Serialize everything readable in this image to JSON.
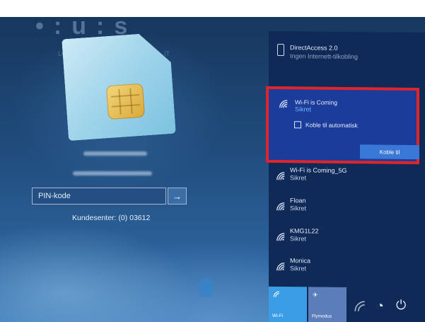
{
  "lock_screen": {
    "pin_input": {
      "placeholder": "PIN-kode",
      "value": ""
    },
    "submit_glyph": "→",
    "kundesenter": "Kundesenter: (0) 03612"
  },
  "network_flyout": {
    "direct_access": {
      "name": "DirectAccess 2.0",
      "status": "Ingen Internett-tilkobling"
    },
    "active_network": {
      "name": "Wi-Fi is Coming",
      "status": "Sikret",
      "auto_connect_label": "Koble til automatisk",
      "auto_connect_checked": false,
      "connect_label": "Koble til"
    },
    "networks": [
      {
        "name": "Wi-Fi is Coming_5G",
        "status": "Sikret"
      },
      {
        "name": "Floan",
        "status": "Sikret"
      },
      {
        "name": "KMG1L22",
        "status": "Sikret"
      },
      {
        "name": "Monica",
        "status": "Sikret"
      }
    ],
    "quick_actions": [
      {
        "label": "Wi-Fi",
        "icon": "wifi-icon",
        "active": true
      },
      {
        "label": "Flymodus",
        "icon": "airplane-icon",
        "active": false
      }
    ]
  },
  "system_icons": [
    "accessibility-icon",
    "power-icon"
  ],
  "colors": {
    "highlight_border": "#e0252a",
    "flyout_bg": "#0f2a57",
    "active_tile": "#3b9de6",
    "connect_button": "#3a78d8"
  }
}
